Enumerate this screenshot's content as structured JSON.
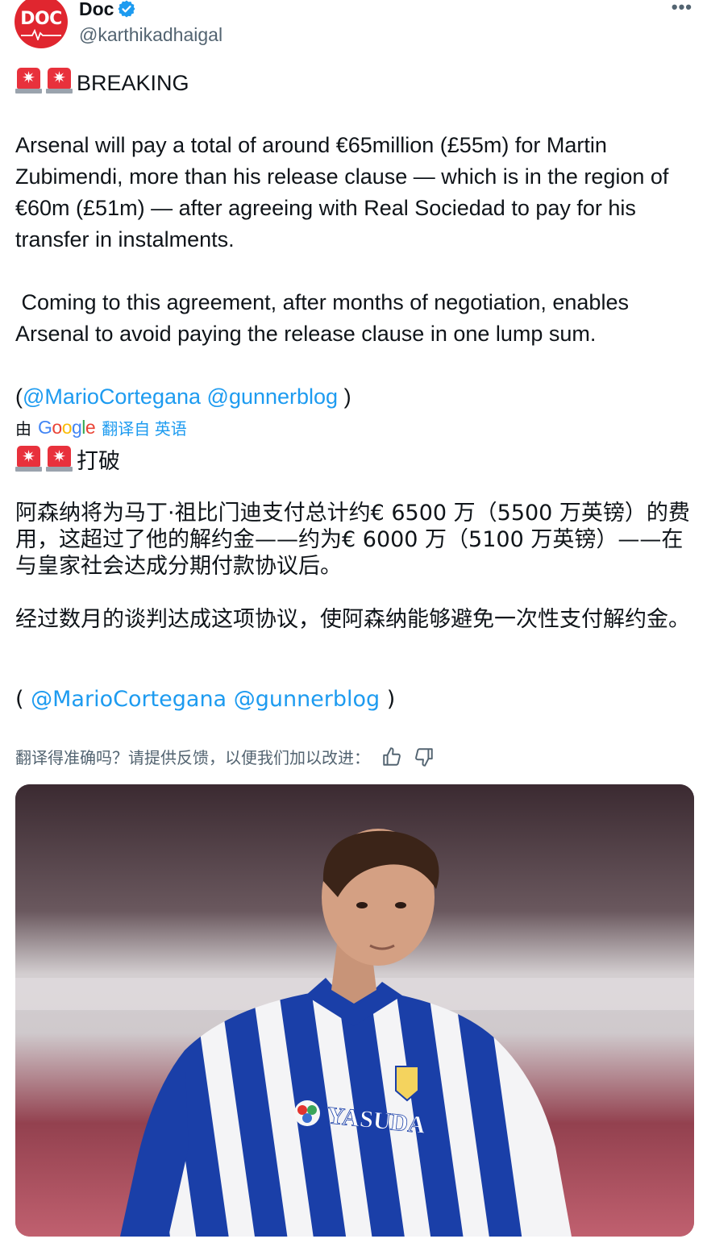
{
  "author": {
    "name": "Doc",
    "handle": "@karthikadhaigal",
    "avatar_text": "DOC",
    "verified": true
  },
  "menu": {
    "more_label": "•••"
  },
  "tweet": {
    "headline": "BREAKING",
    "para1": "Arsenal will pay a total of around €65million (£55m) for Martin Zubimendi, more than his release clause — which is in the region of €60m (£51m) — after agreeing with Real Sociedad to pay for his transfer in instalments.",
    "para2": " Coming to this agreement, after months of negotiation, enables Arsenal to avoid paying the release clause in one lump sum.",
    "credit_open": "(",
    "mention1": "@MarioCortegana",
    "mention2": "@gunnerblog",
    "credit_close": " )"
  },
  "translation": {
    "by_label": "由",
    "google": [
      "G",
      "o",
      "o",
      "g",
      "l",
      "e"
    ],
    "link_label": "翻译自 英语",
    "headline": "打破",
    "para1": "阿森纳将为马丁·祖比门迪支付总计约€ 6500 万（5500 万英镑）的费用，这超过了他的解约金——约为€ 6000 万（5100 万英镑）——在与皇家社会达成分期付款协议后。",
    "para2": "经过数月的谈判达成这项协议，使阿森纳能够避免一次性支付解约金。",
    "credit_open": "( ",
    "mention1": "@MarioCortegana",
    "mention2": "@gunnerblog",
    "credit_close": " )"
  },
  "feedback": {
    "prompt": "翻译得准确吗？请提供反馈，以便我们加以改进："
  },
  "media": {
    "jersey_sponsor": "YASUDA",
    "colors": {
      "stripe_blue": "#1a3fa8",
      "stripe_white": "#f4f4f6"
    }
  },
  "colors": {
    "accent": "#1d9bf0",
    "secondary_text": "#536471",
    "siren": "#e8313c"
  }
}
